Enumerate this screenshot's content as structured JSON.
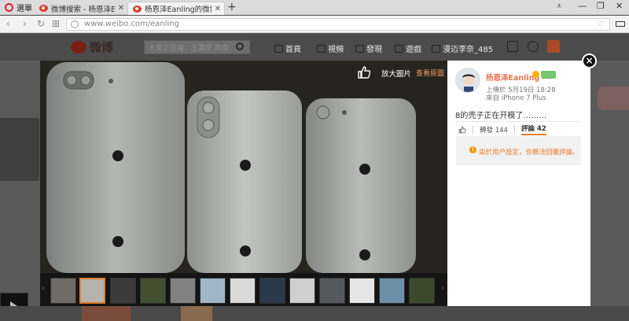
{
  "browser": {
    "menu_label": "選單",
    "tabs": [
      {
        "label": "微博搜索 - 杨恩泽Eanling"
      },
      {
        "label": "杨恩泽Eanling的微博_微博"
      }
    ],
    "new_tab": "+",
    "url": "www.weibo.com/eanling"
  },
  "weibo_header": {
    "logo_text": "微博",
    "search_placeholder": "大家正在搜：王源宗 鼎鼎",
    "nav": [
      "首頁",
      "視頻",
      "發現",
      "遊戲"
    ],
    "username": "漫迈李奈_485"
  },
  "viewer": {
    "enlarge_label": "放大圖片",
    "original_label": "查看原圖"
  },
  "post": {
    "author": "杨恩泽Eanling",
    "time": "上傳於 5月19日 18:28",
    "source": "來自 iPhone 7 Plus",
    "text": "8的壳子正在开模了………",
    "reposts": "轉發 144",
    "comments": "評論 42",
    "notice": "由於用户設定，你無法回覆評論。"
  },
  "icons": {
    "like": "thumbs-up-icon",
    "close": "close-icon",
    "warning": "warning-icon"
  },
  "colors": {
    "accent": "#eb7350",
    "notice": "#e87a2c",
    "thumb_active": "#e57c2a"
  }
}
